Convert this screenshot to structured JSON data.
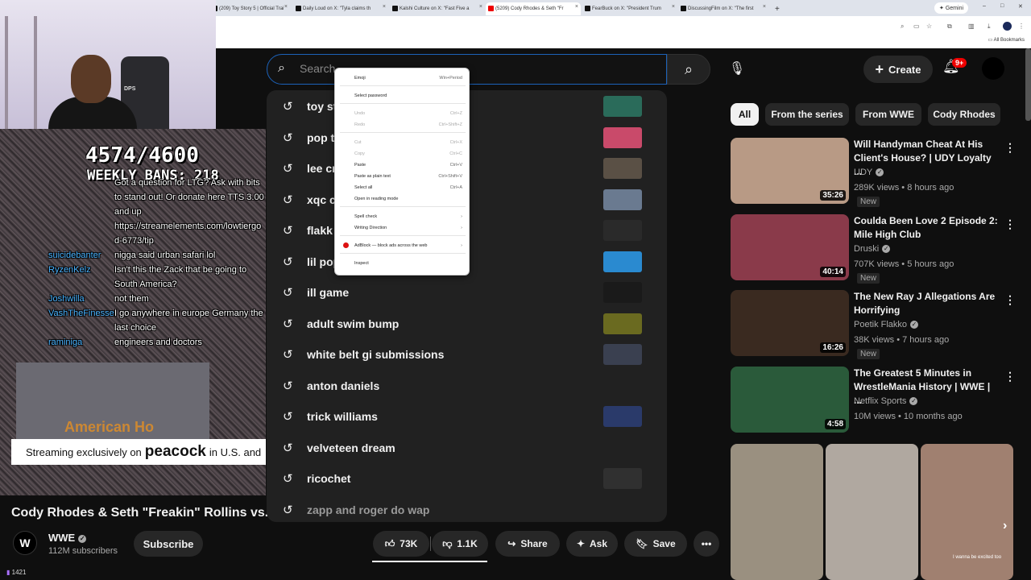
{
  "browser": {
    "tabs": [
      {
        "label": "(209) Toy Story 5 | Official Trai",
        "active": false
      },
      {
        "label": "Daily Loud on X: \"Tyla claims th",
        "active": false
      },
      {
        "label": "Kalshi Culture on X: \"Fast Five a",
        "active": false
      },
      {
        "label": "(5209) Cody Rhodes & Seth \"Fr",
        "active": true
      },
      {
        "label": "FearBuck on X: \"President Trum",
        "active": false
      },
      {
        "label": "DiscussingFilm on X: \"The first",
        "active": false
      }
    ],
    "gemini_label": "Gemini",
    "bookmarks_label": "All Bookmarks"
  },
  "stream": {
    "chair_label": "DPS",
    "counter": "4574/4600",
    "bans": "WEEKLY BANS: 218",
    "chat": [
      {
        "user": "",
        "msg": "Got a question for LTG? Ask with bits"
      },
      {
        "user": "",
        "msg": "to stand out! Or donate here TTS 3.00"
      },
      {
        "user": "",
        "msg": "and up"
      },
      {
        "user": "",
        "msg": "https://streamelements.com/lowtiergo"
      },
      {
        "user": "",
        "msg": "d-6773/tip"
      },
      {
        "user": "suicidebanter",
        "msg": "nigga said urban safari lol"
      },
      {
        "user": "RyzenKelz",
        "msg": "Isn't this the Zack that be going to"
      },
      {
        "user": "",
        "msg": "South America?"
      },
      {
        "user": "Joshwilla",
        "msg": "not them"
      },
      {
        "user": "VashTheFinesse",
        "msg": "I go anywhere in europe Germany the"
      },
      {
        "user": "",
        "msg": "last choice"
      },
      {
        "user": "raminiga",
        "msg": "engineers and doctors"
      }
    ],
    "sponsor_pre": "Streaming exclusively on",
    "sponsor_brand": "peacock",
    "sponsor_post": "in U.S. and",
    "viewer_count": "1421"
  },
  "video": {
    "title": "Cody Rhodes & Seth \"Freakin\" Rollins vs...",
    "channel": "WWE",
    "subscribers": "112M subscribers",
    "subscribe_label": "Subscribe",
    "likes": "73K",
    "dislikes": "1.1K",
    "share_label": "Share",
    "ask_label": "Ask",
    "save_label": "Save"
  },
  "header": {
    "search_placeholder": "Search",
    "create_label": "Create",
    "notif_count": "9+"
  },
  "suggestions": [
    {
      "text": "toy st",
      "thumb": "#2a6b5a"
    },
    {
      "text": "pop t",
      "thumb": "#c94a6a"
    },
    {
      "text": "lee cr",
      "thumb": "#5a5045"
    },
    {
      "text": "xqc c",
      "thumb": "#6a7a90"
    },
    {
      "text": "flakk",
      "thumb": "#2a2a2a"
    },
    {
      "text": "lil pop",
      "thumb": "#2a8ad0"
    },
    {
      "text": "ill game",
      "thumb": "#1a1a1a"
    },
    {
      "text": "adult swim bump",
      "thumb": "#6a6a20"
    },
    {
      "text": "white belt gi submissions",
      "thumb": "#3a4050"
    },
    {
      "text": "anton daniels",
      "thumb": ""
    },
    {
      "text": "trick williams",
      "thumb": "#2a3a6a"
    },
    {
      "text": "velveteen dream",
      "thumb": ""
    },
    {
      "text": "ricochet",
      "thumb": "#303030"
    },
    {
      "text": "zapp and roger do wap",
      "thumb": ""
    }
  ],
  "context_menu": [
    {
      "label": "Emoji",
      "shortcut": "Win+Period",
      "disabled": false,
      "sep_after": true
    },
    {
      "label": "Select password",
      "shortcut": "",
      "disabled": false,
      "sep_after": true
    },
    {
      "label": "Undo",
      "shortcut": "Ctrl+Z",
      "disabled": true,
      "sep_after": false
    },
    {
      "label": "Redo",
      "shortcut": "Ctrl+Shift+Z",
      "disabled": true,
      "sep_after": true
    },
    {
      "label": "Cut",
      "shortcut": "Ctrl+X",
      "disabled": true,
      "sep_after": false
    },
    {
      "label": "Copy",
      "shortcut": "Ctrl+C",
      "disabled": true,
      "sep_after": false
    },
    {
      "label": "Paste",
      "shortcut": "Ctrl+V",
      "disabled": false,
      "sep_after": false
    },
    {
      "label": "Paste as plain text",
      "shortcut": "Ctrl+Shift+V",
      "disabled": false,
      "sep_after": false
    },
    {
      "label": "Select all",
      "shortcut": "Ctrl+A",
      "disabled": false,
      "sep_after": false
    },
    {
      "label": "Open in reading mode",
      "shortcut": "",
      "disabled": false,
      "sep_after": true
    },
    {
      "label": "Spell check",
      "shortcut": "›",
      "disabled": false,
      "sep_after": false
    },
    {
      "label": "Writing Direction",
      "shortcut": "›",
      "disabled": false,
      "sep_after": true
    },
    {
      "label": "AdBlock — block ads across the web",
      "shortcut": "›",
      "disabled": false,
      "sep_after": true
    },
    {
      "label": "Inspect",
      "shortcut": "",
      "disabled": false,
      "sep_after": false
    }
  ],
  "chips": [
    "All",
    "From the series",
    "From WWE",
    "Cody Rhodes"
  ],
  "recommendations": [
    {
      "title": "Will Handyman Cheat At His Client's House? | UDY Loyalty ...",
      "channel": "UDY",
      "views": "289K views • 8 hours ago",
      "duration": "35:26",
      "is_new": "New",
      "thumb": "#b89a85"
    },
    {
      "title": "Coulda Been Love 2 Episode 2: Mile High Club",
      "channel": "Druski",
      "views": "707K views • 5 hours ago",
      "duration": "40:14",
      "is_new": "New",
      "thumb": "#8a3a4a"
    },
    {
      "title": "The New Ray J Allegations Are Horrifying",
      "channel": "Poetik Flakko",
      "views": "38K views • 7 hours ago",
      "duration": "16:26",
      "is_new": "New",
      "thumb": "#3a2a20"
    },
    {
      "title": "The Greatest 5 Minutes in WrestleMania History | WWE | ...",
      "channel": "Netflix Sports",
      "views": "10M views • 10 months ago",
      "duration": "4:58",
      "is_new": "",
      "thumb": "#2a5a3a"
    }
  ],
  "shorts": [
    {
      "thumb": "#9a9080"
    },
    {
      "thumb": "#b0a8a0"
    },
    {
      "thumb": "#a08070",
      "caption": "I wanna be excited too"
    }
  ],
  "colors": {
    "accent_blue": "#1c62b9",
    "notification_red": "#e00000"
  }
}
